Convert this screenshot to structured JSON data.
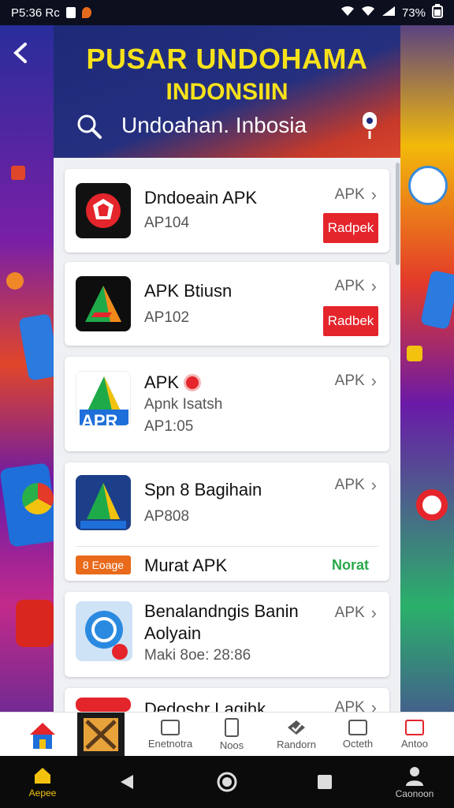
{
  "status_bar": {
    "time": "P5:36 Rc",
    "battery": "73%"
  },
  "header": {
    "title_line1": "PUSAR UNDOHAMA",
    "title_line2": "INDONSIIN",
    "search_text": "Undoahan. Inbosia"
  },
  "apps": [
    {
      "name": "Dndoeain APK",
      "sub": "AP104",
      "link": "APK",
      "action": "Radpek"
    },
    {
      "name": "APK Btiusn",
      "sub": "AP102",
      "link": "APK",
      "action": "Radbek"
    },
    {
      "name": "APK",
      "sub": "Apnk Isatsh",
      "sub2": "AP1:05",
      "link": "APK"
    },
    {
      "name": "Spn 8 Bagihain",
      "sub": "AP808",
      "link": "APK",
      "tag": "8 Eoage",
      "extra_name": "Murat APK",
      "extra_link": "Norat"
    },
    {
      "name": "Benalandngis Banin",
      "name2": "Aolyain",
      "sub": "Maki 8oe: 28:86",
      "link": "APK"
    },
    {
      "name": "Dedoshr Lagihk",
      "link": "APK"
    }
  ],
  "bottom_nav": [
    {
      "label": "",
      "icon": "home-icon"
    },
    {
      "label": "",
      "icon": "tools-icon"
    },
    {
      "label": "Enetnotra",
      "icon": "store-icon"
    },
    {
      "label": "Noos",
      "icon": "phone-icon"
    },
    {
      "label": "Randorn",
      "icon": "shield-icon"
    },
    {
      "label": "Octeth",
      "icon": "box-icon"
    },
    {
      "label": "Antoo",
      "icon": "flag-icon"
    }
  ],
  "system_bar": {
    "left_label": "Aepee",
    "right_label": "Caonoon"
  },
  "colors": {
    "accent_red": "#e4252b",
    "title_yellow": "#f7e21a",
    "header_blue": "#1d2a78"
  }
}
